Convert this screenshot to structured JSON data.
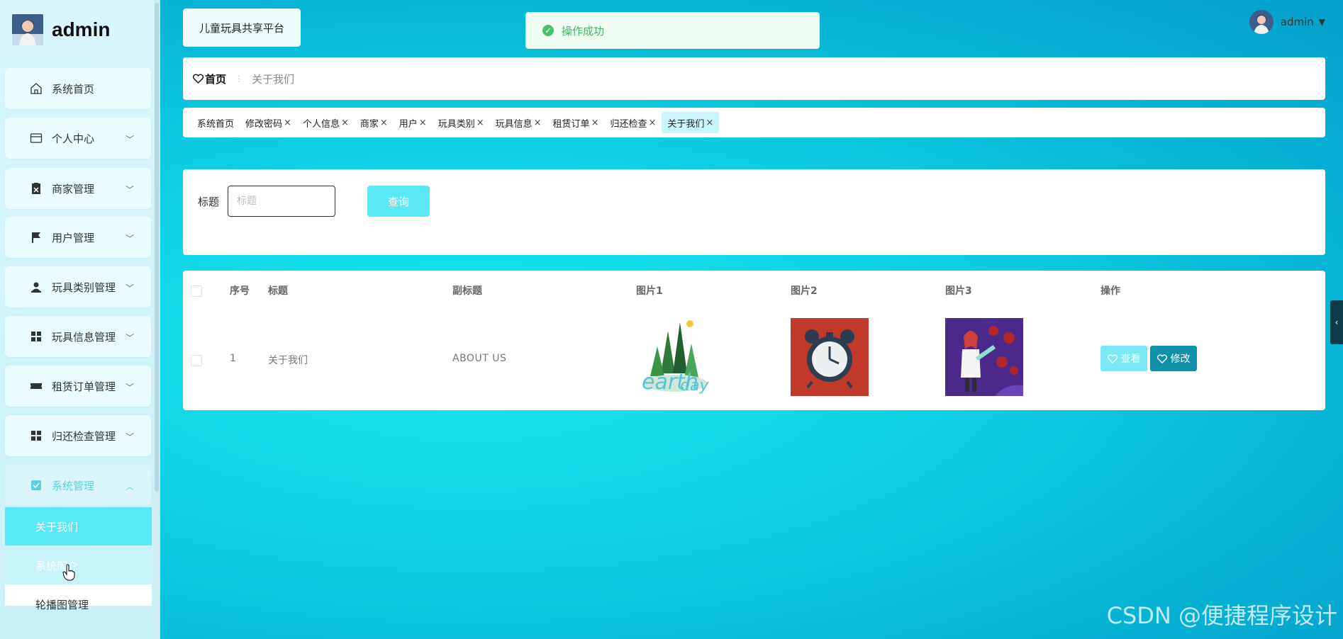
{
  "brand": {
    "name": "admin"
  },
  "sidebar": {
    "items": [
      {
        "label": "系统首页",
        "icon": "home-icon"
      },
      {
        "label": "个人中心",
        "icon": "card-icon"
      },
      {
        "label": "商家管理",
        "icon": "clipboard-icon"
      },
      {
        "label": "用户管理",
        "icon": "flag-icon"
      },
      {
        "label": "玩具类别管理",
        "icon": "person-icon"
      },
      {
        "label": "玩具信息管理",
        "icon": "grid-icon"
      },
      {
        "label": "租赁订单管理",
        "icon": "ticket-icon"
      },
      {
        "label": "归还检查管理",
        "icon": "grid-icon"
      },
      {
        "label": "系统管理",
        "icon": "check-square-icon"
      }
    ],
    "submenu": [
      {
        "label": "关于我们"
      },
      {
        "label": "系统简介"
      },
      {
        "label": "轮播图管理"
      }
    ]
  },
  "header": {
    "platform_title": "儿童玩具共享平台",
    "user": "admin",
    "toast": "操作成功"
  },
  "breadcrumb": {
    "home": "首页",
    "current": "关于我们"
  },
  "tags": [
    {
      "label": "系统首页",
      "closable": false
    },
    {
      "label": "修改密码",
      "closable": true
    },
    {
      "label": "个人信息",
      "closable": true
    },
    {
      "label": "商家",
      "closable": true
    },
    {
      "label": "用户",
      "closable": true
    },
    {
      "label": "玩具类别",
      "closable": true
    },
    {
      "label": "玩具信息",
      "closable": true
    },
    {
      "label": "租赁订单",
      "closable": true
    },
    {
      "label": "归还检查",
      "closable": true
    },
    {
      "label": "关于我们",
      "closable": true,
      "active": true
    }
  ],
  "search": {
    "label": "标题",
    "placeholder": "标题",
    "button": "查询"
  },
  "table": {
    "headers": {
      "index": "序号",
      "title": "标题",
      "subtitle": "副标题",
      "pic1": "图片1",
      "pic2": "图片2",
      "pic3": "图片3",
      "actions": "操作"
    },
    "rows": [
      {
        "index": "1",
        "title": "关于我们",
        "subtitle": "ABOUT US",
        "view": "查看",
        "edit": "修改"
      }
    ]
  },
  "watermark": "CSDN @便捷程序设计",
  "colors": {
    "accent": "#57e9f5",
    "edit_button": "#1191a9",
    "success": "#47c165"
  }
}
